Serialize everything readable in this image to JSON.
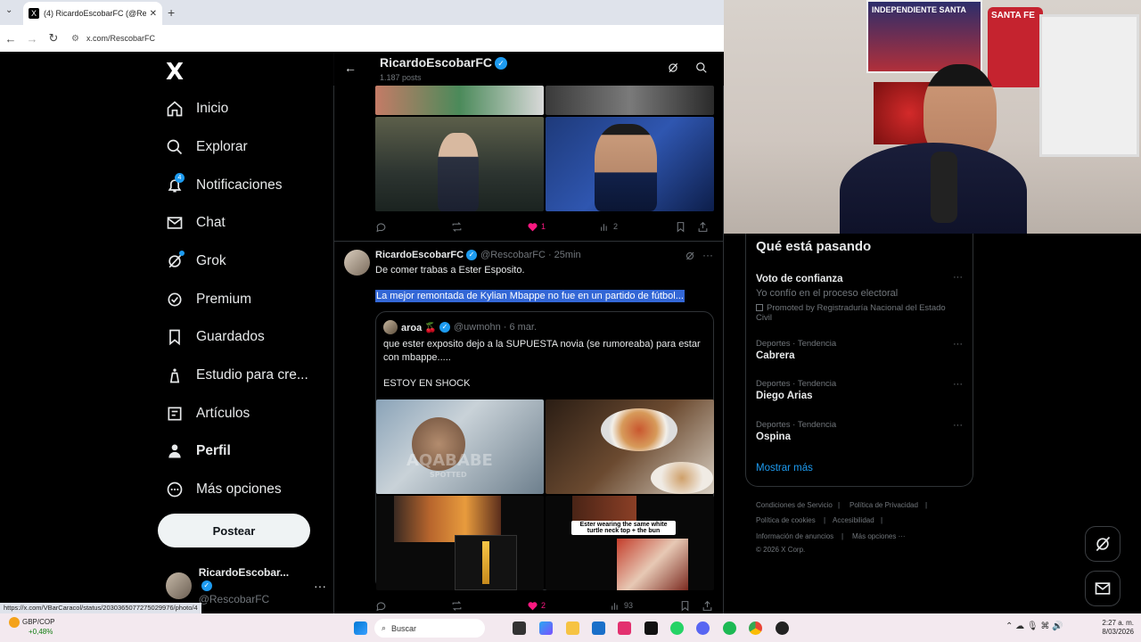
{
  "browser": {
    "tab_title": "(4) RicardoEscobarFC (@Rescob",
    "url": "x.com/RescobarFC",
    "status_url": "https://x.com/VBarCaracol/status/2030365077275029976/photo/4"
  },
  "nav": {
    "items": [
      {
        "label": "Inicio",
        "icon": "home-icon"
      },
      {
        "label": "Explorar",
        "icon": "search-icon"
      },
      {
        "label": "Notificaciones",
        "icon": "bell-icon",
        "badge": "4"
      },
      {
        "label": "Chat",
        "icon": "mail-icon"
      },
      {
        "label": "Grok",
        "icon": "grok-icon"
      },
      {
        "label": "Premium",
        "icon": "premium-icon"
      },
      {
        "label": "Guardados",
        "icon": "bookmark-icon"
      },
      {
        "label": "Estudio para cre...",
        "icon": "studio-icon"
      },
      {
        "label": "Artículos",
        "icon": "article-icon"
      },
      {
        "label": "Perfil",
        "icon": "person-icon"
      },
      {
        "label": "Más opciones",
        "icon": "more-icon"
      }
    ],
    "post_button": "Postear",
    "account": {
      "name": "RicardoEscobar...",
      "handle": "@RescobarFC"
    }
  },
  "header": {
    "name": "RicardoEscobarFC",
    "posts": "1.187 posts"
  },
  "tweet1": {
    "likes": "1",
    "views": "2"
  },
  "tweet2": {
    "name": "RicardoEscobarFC",
    "handle": "@RescobarFC",
    "time": "· 25min",
    "text": "De comer trabas a Ester Esposito.",
    "highlighted": "La mejor remontada de Kylian Mbappe no fue en un partido de fútbol...",
    "likes": "2",
    "views": "93",
    "quote": {
      "name": "aroa 🍒",
      "handle": "@uwmohn",
      "time": "· 6 mar.",
      "text": "que ester exposito dejo a la SUPUESTA novia (se rumoreaba) para estar con mbappe.....",
      "text2": "ESTOY EN SHOCK",
      "watermark": "AQABABE",
      "watermark2": "SPOTTED",
      "caption": "Ester wearing the same white turtle neck top + the bun"
    }
  },
  "trends": {
    "title": "Qué está pasando",
    "promo": {
      "topic": "Voto de confianza",
      "sub": "Yo confío en el proceso electoral",
      "promoted": "Promoted by Registraduría Nacional del Estado Civil"
    },
    "items": [
      {
        "category": "Deportes · Tendencia",
        "topic": "Cabrera"
      },
      {
        "category": "Deportes · Tendencia",
        "topic": "Diego Arias"
      },
      {
        "category": "Deportes · Tendencia",
        "topic": "Ospina"
      }
    ],
    "show_more": "Mostrar más"
  },
  "footer": {
    "links": [
      "Condiciones de Servicio",
      "Política de Privacidad",
      "Política de cookies",
      "Accesibilidad",
      "Información de anuncios",
      "Más opciones ···"
    ],
    "copyright": "© 2026 X Corp."
  },
  "webcam": {
    "banner1": "INDEPENDIENTE SANTA",
    "banner2": "SANTA FE"
  },
  "taskbar": {
    "ticker_name": "GBP/COP",
    "ticker_change": "+0,48%",
    "search_placeholder": "Buscar",
    "time": "2:27 a. m.",
    "date": "8/03/2026"
  },
  "colors": {
    "accent": "#1d9bf0",
    "like": "#f91880",
    "highlight": "#3367d6"
  }
}
